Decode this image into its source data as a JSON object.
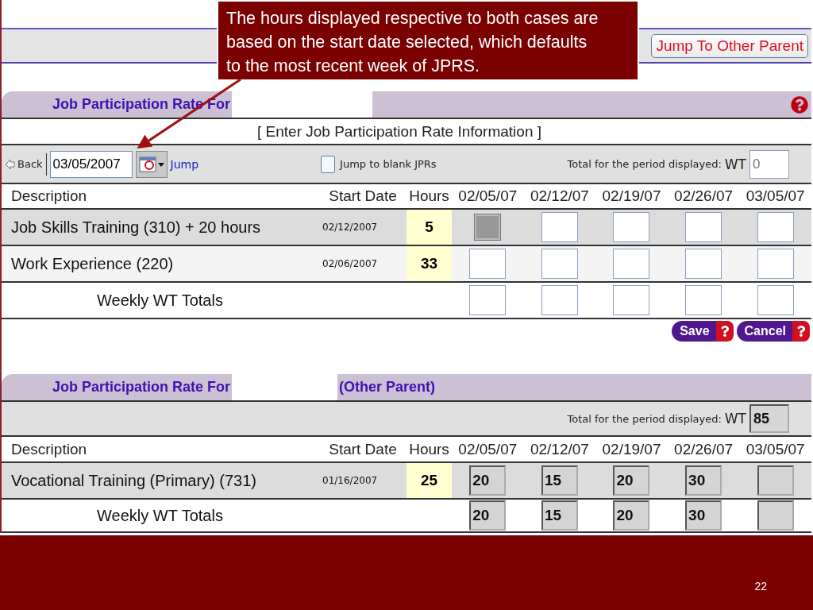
{
  "callout": {
    "text": "The hours displayed respective to both cases are based on the start date selected, which defaults to the most recent week of JPRS."
  },
  "top_bar": {
    "button": "Jump To Other Parent"
  },
  "sections": [
    {
      "title": "Job Participation Rate For",
      "help": true,
      "caption": "[ Enter Job Participation Rate Information ]",
      "toolbar": {
        "back": "Back",
        "date": "03/05/2007",
        "jump": "Jump",
        "checkbox": {
          "label": "Jump to blank JPRs",
          "checked": false
        }
      },
      "total": {
        "label": "Total for the period displayed:",
        "unit": "WT",
        "placeholder": "0",
        "readonly": false
      },
      "columns": [
        "Description",
        "Start Date",
        "Hours"
      ],
      "weeks": [
        "02/05/07",
        "02/12/07",
        "02/19/07",
        "02/26/07",
        "03/05/07"
      ],
      "rows": [
        {
          "description": "Job Skills Training (310) + 20 hours",
          "start_date": "02/12/2007",
          "hours": "5",
          "cells": [
            {
              "kind": "blocked"
            },
            {
              "kind": "input"
            },
            {
              "kind": "input"
            },
            {
              "kind": "input"
            },
            {
              "kind": "input"
            }
          ]
        },
        {
          "description": "Work Experience (220)",
          "start_date": "02/06/2007",
          "hours": "33",
          "cells": [
            {
              "kind": "input"
            },
            {
              "kind": "input"
            },
            {
              "kind": "input"
            },
            {
              "kind": "input"
            },
            {
              "kind": "input"
            }
          ]
        }
      ],
      "totals": {
        "label": "Weekly WT Totals",
        "cells": [
          {
            "kind": "input"
          },
          {
            "kind": "input"
          },
          {
            "kind": "input"
          },
          {
            "kind": "input"
          },
          {
            "kind": "input"
          }
        ]
      },
      "actions": [
        {
          "label": "Save"
        },
        {
          "label": "Cancel"
        }
      ]
    },
    {
      "title": "Job Participation Rate For",
      "other_label": "(Other Parent)",
      "total": {
        "label": "Total for the period displayed:",
        "unit": "WT",
        "value": "85",
        "readonly": true
      },
      "columns": [
        "Description",
        "Start Date",
        "Hours"
      ],
      "weeks": [
        "02/05/07",
        "02/12/07",
        "02/19/07",
        "02/26/07",
        "03/05/07"
      ],
      "rows": [
        {
          "description": "Vocational Training (Primary) (731)",
          "start_date": "01/16/2007",
          "hours": "25",
          "cells": [
            {
              "kind": "readonly",
              "value": "20"
            },
            {
              "kind": "readonly",
              "value": "15"
            },
            {
              "kind": "readonly",
              "value": "20"
            },
            {
              "kind": "readonly",
              "value": "30"
            },
            {
              "kind": "readonly"
            }
          ]
        }
      ],
      "totals": {
        "label": "Weekly WT Totals",
        "cells": [
          {
            "kind": "readonly",
            "value": "20"
          },
          {
            "kind": "readonly",
            "value": "15"
          },
          {
            "kind": "readonly",
            "value": "20"
          },
          {
            "kind": "readonly",
            "value": "30"
          },
          {
            "kind": "readonly"
          }
        ]
      }
    }
  ],
  "footer": {
    "page": "22"
  }
}
